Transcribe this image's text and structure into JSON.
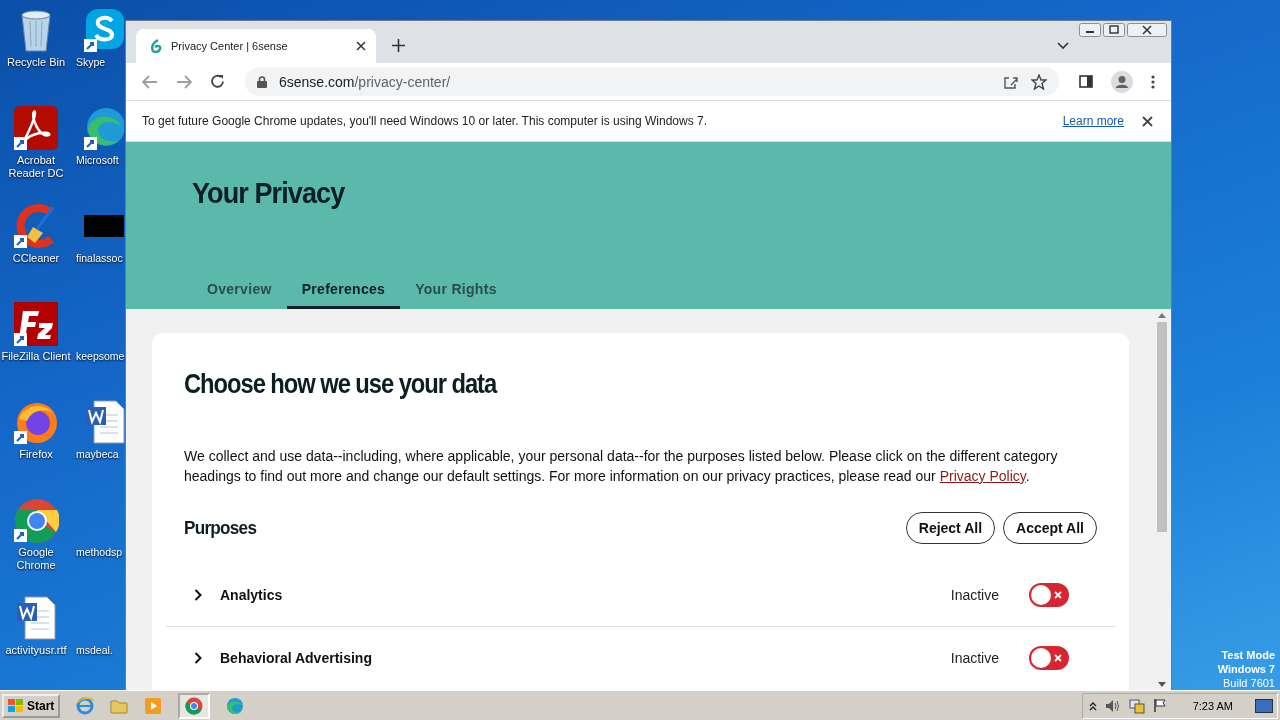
{
  "desktop": {
    "icons": [
      {
        "label": "Recycle Bin",
        "kind": "recycle"
      },
      {
        "label": "Acrobat Reader DC",
        "kind": "acrobat"
      },
      {
        "label": "CCleaner",
        "kind": "ccleaner"
      },
      {
        "label": "FileZilla Client",
        "kind": "filezilla"
      },
      {
        "label": "Firefox",
        "kind": "firefox"
      },
      {
        "label": "Google Chrome",
        "kind": "chrome"
      },
      {
        "label": "activityusr.rtf",
        "kind": "word"
      },
      {
        "label": "Skype",
        "kind": "skype"
      },
      {
        "label": "Microsoft",
        "kind": "edge"
      },
      {
        "label": "finalassoc",
        "kind": "black"
      },
      {
        "label": "keepsome",
        "kind": "none"
      },
      {
        "label": "maybeca",
        "kind": "word"
      },
      {
        "label": "methodsp",
        "kind": "none"
      },
      {
        "label": "msdeal.",
        "kind": "none"
      }
    ],
    "watermark": [
      "Test Mode",
      "Windows 7",
      "Build 7601"
    ]
  },
  "browser": {
    "tab_title": "Privacy Center | 6sense",
    "url": "6sense.com/privacy-center/",
    "infobar": {
      "text": "To get future Google Chrome updates, you'll need Windows 10 or later. This computer is using Windows 7.",
      "link": "Learn more"
    },
    "page": {
      "title": "Your Privacy",
      "tabs": [
        {
          "label": "Overview",
          "selected": false
        },
        {
          "label": "Preferences",
          "selected": true
        },
        {
          "label": "Your Rights",
          "selected": false
        }
      ],
      "heading": "Choose how we use your data",
      "paragraph": "We collect and use data--including, where applicable, your personal data--for the purposes listed below. Please click on the different category headings to find out more and change our default settings. For more information on our privacy practices, please read our ",
      "paragraph_link": "Privacy Policy",
      "paragraph_end": ".",
      "purposes_title": "Purposes",
      "buttons": [
        "Reject All",
        "Accept All"
      ],
      "purposes": [
        {
          "label": "Analytics",
          "status": "Inactive",
          "active": false
        },
        {
          "label": "Behavioral Advertising",
          "status": "Inactive",
          "active": false
        }
      ]
    }
  },
  "taskbar": {
    "start": "Start",
    "clock": "7:23 AM"
  }
}
